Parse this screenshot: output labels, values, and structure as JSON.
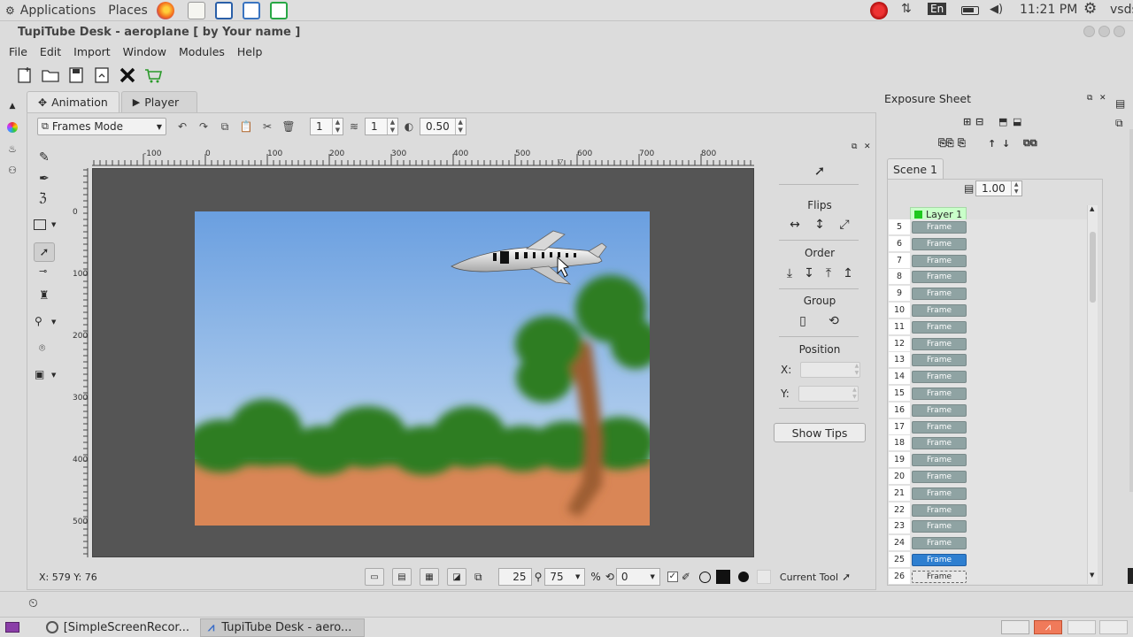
{
  "top_panel": {
    "applications": "Applications",
    "places": "Places",
    "language": "En",
    "time": "11:21 PM",
    "user": "vsds"
  },
  "window": {
    "title": "TupiTube Desk - aeroplane [ by Your name ]"
  },
  "menu": [
    "File",
    "Edit",
    "Import",
    "Window",
    "Modules",
    "Help"
  ],
  "tabs": {
    "animation": "Animation",
    "player": "Player"
  },
  "frame_toolbar": {
    "mode": "Frames Mode",
    "spin1": "1",
    "spin2": "1",
    "opacity": "0.50"
  },
  "rulers": {
    "top": [
      "-100",
      "0",
      "100",
      "200",
      "300",
      "400",
      "500",
      "600",
      "700",
      "800"
    ],
    "left": [
      "0",
      "100",
      "200",
      "300",
      "400",
      "500"
    ]
  },
  "props": {
    "flips": "Flips",
    "order": "Order",
    "group": "Group",
    "position": "Position",
    "x_label": "X:",
    "y_label": "Y:",
    "show_tips": "Show Tips"
  },
  "status": {
    "coords": "X: 579 Y: 76",
    "rotation": "25",
    "zoom": "75",
    "zoom_unit": "%",
    "angle": "0",
    "current_tool": "Current Tool"
  },
  "exposure": {
    "title": "Exposure Sheet",
    "scene_tab": "Scene 1",
    "fps": "1.00",
    "layer": "Layer 1",
    "frames": [
      {
        "num": "5",
        "label": "Frame",
        "state": "normal"
      },
      {
        "num": "6",
        "label": "Frame",
        "state": "normal"
      },
      {
        "num": "7",
        "label": "Frame",
        "state": "normal"
      },
      {
        "num": "8",
        "label": "Frame",
        "state": "normal"
      },
      {
        "num": "9",
        "label": "Frame",
        "state": "normal"
      },
      {
        "num": "10",
        "label": "Frame",
        "state": "normal"
      },
      {
        "num": "11",
        "label": "Frame",
        "state": "normal"
      },
      {
        "num": "12",
        "label": "Frame",
        "state": "normal"
      },
      {
        "num": "13",
        "label": "Frame",
        "state": "normal"
      },
      {
        "num": "14",
        "label": "Frame",
        "state": "normal"
      },
      {
        "num": "15",
        "label": "Frame",
        "state": "normal"
      },
      {
        "num": "16",
        "label": "Frame",
        "state": "normal"
      },
      {
        "num": "17",
        "label": "Frame",
        "state": "normal"
      },
      {
        "num": "18",
        "label": "Frame",
        "state": "normal"
      },
      {
        "num": "19",
        "label": "Frame",
        "state": "normal"
      },
      {
        "num": "20",
        "label": "Frame",
        "state": "normal"
      },
      {
        "num": "21",
        "label": "Frame",
        "state": "normal"
      },
      {
        "num": "22",
        "label": "Frame",
        "state": "normal"
      },
      {
        "num": "23",
        "label": "Frame",
        "state": "normal"
      },
      {
        "num": "24",
        "label": "Frame",
        "state": "normal"
      },
      {
        "num": "25",
        "label": "Frame",
        "state": "selected"
      },
      {
        "num": "26",
        "label": "Frame",
        "state": "dashed"
      }
    ]
  },
  "taskbar": {
    "task1": "[SimpleScreenRecor...",
    "task2": "TupiTube Desk - aero..."
  },
  "colors": {
    "sky_top": "#6a9fe0",
    "sky_bottom": "#cde0f2",
    "ground": "#d98656",
    "foliage": "#2e7d24",
    "trunk": "#9c5d33",
    "workspace": "#555555",
    "selected_frame": "#2e7fd0",
    "layer_indicator": "#1ec81e"
  }
}
